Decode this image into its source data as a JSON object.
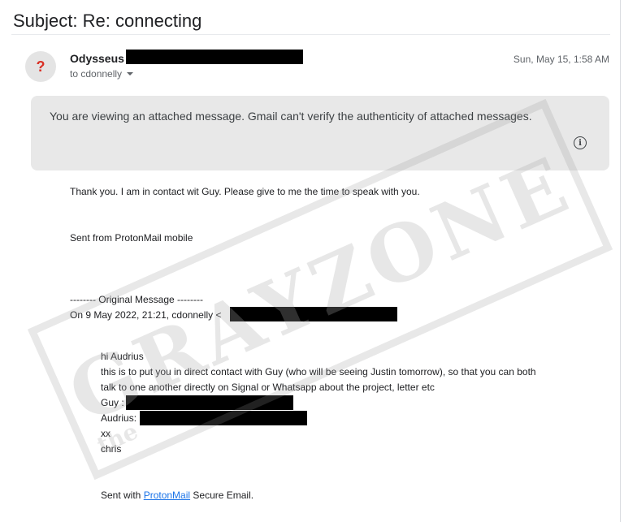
{
  "subject": "Subject: Re: connecting",
  "message": {
    "sender_name": "Odysseus",
    "recipient_prefix": "to cdonnelly",
    "date": "Sun, May 15, 1:58 AM",
    "avatar_glyph": "?",
    "avatar_glyph_color": "#d93025"
  },
  "notice": {
    "text": "You are viewing an attached message. Gmail can't verify the authenticity of attached messages.",
    "icon": "info-icon"
  },
  "body": {
    "line1": "Thank you. I am in contact wit Guy. Please give to me the time to speak with you.",
    "line2": "Sent from ProtonMail mobile",
    "orig_header": "-------- Original Message --------",
    "orig_date": "On 9 May 2022, 21:21, cdonnelly <",
    "quoted": {
      "greeting": "hi Audrius",
      "line_a": "this is to put you in direct contact with Guy (who will be seeing Justin tomorrow), so that you can both",
      "line_b": "talk to one another directly on Signal or Whatsapp about the project, letter etc",
      "guy_label": "Guy :",
      "audrius_label": "Audrius:",
      "xx": "xx",
      "signoff": "chris"
    },
    "footer_pre": "Sent with ",
    "footer_link": "ProtonMail",
    "footer_post": " Secure Email."
  },
  "watermark": {
    "text": "GRAYZONE",
    "tm": "the"
  }
}
